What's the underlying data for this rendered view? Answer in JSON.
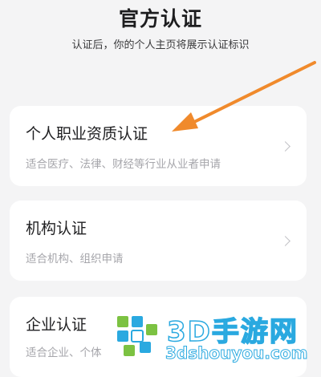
{
  "header": {
    "title": "官方认证",
    "subtitle": "认证后，你的个人主页将展示认证标识"
  },
  "cards": [
    {
      "title": "个人职业资质认证",
      "description": "适合医疗、法律、财经等行业从业者申请"
    },
    {
      "title": "机构认证",
      "description": "适合机构、组织申请"
    },
    {
      "title": "企业认证",
      "description": "适合企业、个体"
    }
  ],
  "watermark": {
    "brand": "3D手游网",
    "url": "3dshouyou.com"
  },
  "colors": {
    "arrow": "#f08a2c",
    "watermark_accent": "#2aa9e0",
    "watermark_green": "#7cc242"
  }
}
